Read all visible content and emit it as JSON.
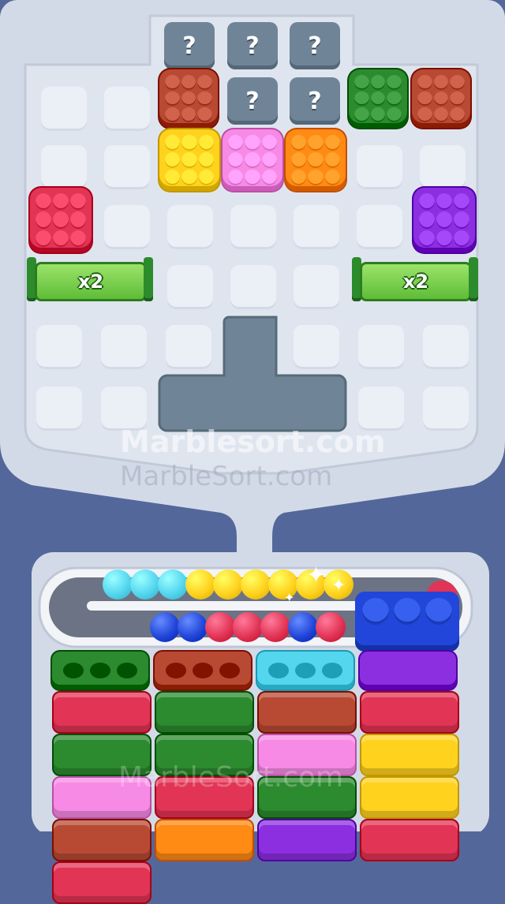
{
  "watermark": {
    "primary": "Marblesort.com",
    "secondary": "MarbleSort.com",
    "footer": "MarbleSort.com"
  },
  "mystery_label": "?",
  "multipliers": {
    "left": "x2",
    "right": "x2"
  },
  "colors": {
    "red": "#e23455",
    "brown": "#b84a34",
    "green": "#2c8a2f",
    "yellow": "#ffd21e",
    "pink": "#f78ae4",
    "orange": "#ff8a14",
    "purple": "#8b2fe0",
    "blue": "#2146d9",
    "cyan": "#55d6ef",
    "board": "#dde3ee",
    "frame": "#54679a"
  },
  "blocks": [
    {
      "name": "brown-block-top",
      "color": "brown"
    },
    {
      "name": "green-block",
      "color": "green"
    },
    {
      "name": "brown-block-right",
      "color": "brown"
    },
    {
      "name": "yellow-block",
      "color": "yellow"
    },
    {
      "name": "pink-block",
      "color": "pink"
    },
    {
      "name": "orange-block",
      "color": "orange"
    },
    {
      "name": "red-block",
      "color": "red"
    },
    {
      "name": "purple-block",
      "color": "purple"
    }
  ],
  "conveyor": {
    "top_row": [
      "cyan",
      "cyan",
      "cyan",
      "yellow",
      "yellow",
      "yellow",
      "yellow",
      "yellow",
      "yellow"
    ],
    "bottom_row": [
      "blue",
      "blue",
      "red",
      "red",
      "red",
      "blue",
      "red"
    ]
  },
  "columns": [
    {
      "top": "green",
      "stack": [
        "red",
        "green",
        "pink",
        "brown",
        "red"
      ]
    },
    {
      "top": "brown",
      "stack": [
        "green",
        "green",
        "red",
        "orange"
      ]
    },
    {
      "top": "cyan",
      "stack": [
        "brown",
        "pink",
        "green",
        "purple"
      ]
    },
    {
      "top": "purple",
      "stack": [
        "red",
        "yellow",
        "yellow",
        "red"
      ]
    }
  ]
}
